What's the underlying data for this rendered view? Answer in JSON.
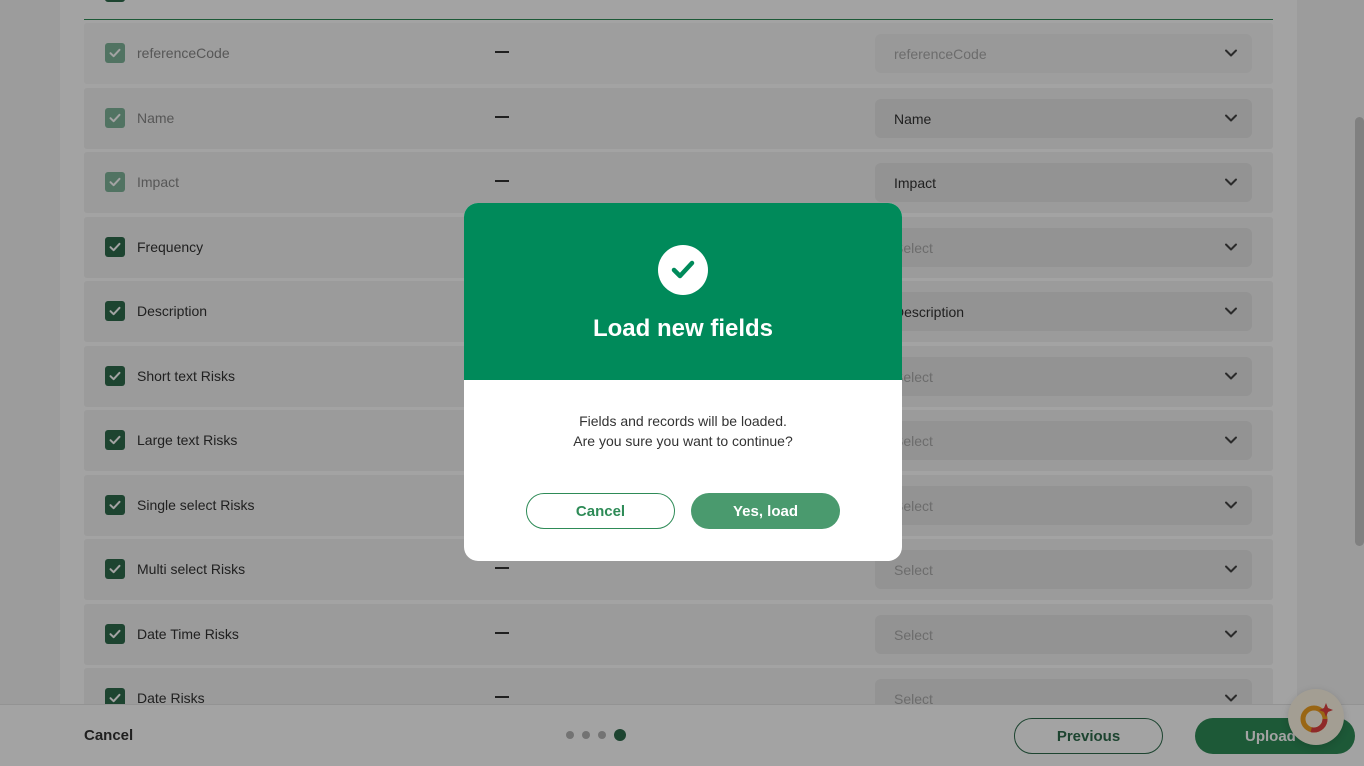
{
  "rows": [
    {
      "field": "referenceCode",
      "mapped": "referenceCode",
      "disabled": true,
      "placeholder": false
    },
    {
      "field": "Name",
      "mapped": "Name",
      "disabled": true,
      "placeholder": false
    },
    {
      "field": "Impact",
      "mapped": "Impact",
      "disabled": true,
      "placeholder": false
    },
    {
      "field": "Frequency",
      "mapped": "Select",
      "disabled": false,
      "placeholder": true
    },
    {
      "field": "Description",
      "mapped": "Description",
      "disabled": false,
      "placeholder": false
    },
    {
      "field": "Short text Risks",
      "mapped": "Select",
      "disabled": false,
      "placeholder": true
    },
    {
      "field": "Large text Risks",
      "mapped": "Select",
      "disabled": false,
      "placeholder": true
    },
    {
      "field": "Single select Risks",
      "mapped": "Select",
      "disabled": false,
      "placeholder": true
    },
    {
      "field": "Multi select Risks",
      "mapped": "Select",
      "disabled": false,
      "placeholder": true
    },
    {
      "field": "Date Time Risks",
      "mapped": "Select",
      "disabled": false,
      "placeholder": true
    },
    {
      "field": "Date Risks",
      "mapped": "Select",
      "disabled": false,
      "placeholder": true
    }
  ],
  "footer": {
    "cancel_label": "Cancel",
    "previous_label": "Previous",
    "upload_label": "Upload",
    "steps_total": 4,
    "current_step": 4
  },
  "modal": {
    "title": "Load new fields",
    "message_line1": "Fields and records will be loaded.",
    "message_line2": "Are you sure you want to continue?",
    "cancel_label": "Cancel",
    "confirm_label": "Yes, load"
  },
  "colors": {
    "primary": "#008a5a",
    "checkbox": "#2e6b4c"
  }
}
